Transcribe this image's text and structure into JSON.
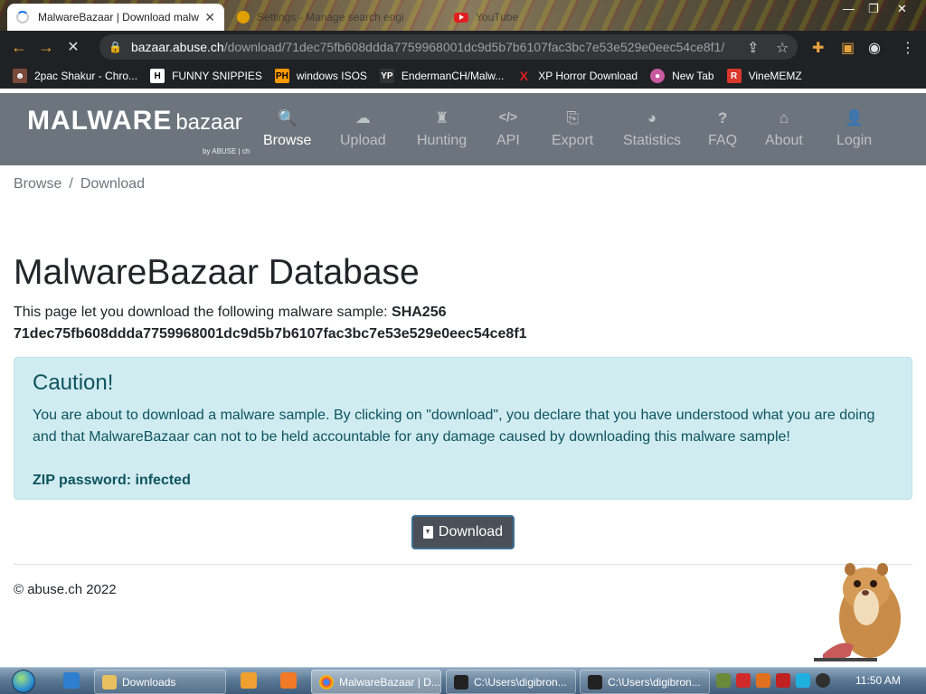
{
  "browser": {
    "tabs": [
      {
        "title": "MalwareBazaar | Download malw",
        "close": "✕"
      },
      {
        "title": "Settings - Manage search engi"
      },
      {
        "title": "YouTube"
      }
    ],
    "url_host": "bazaar.abuse.ch",
    "url_path": "/download/71dec75fb608ddda7759968001dc9d5b7b6107fac3bc7e53e529e0eec54ce8f1/",
    "bookmarks": [
      {
        "label": "2pac Shakur - Chro...",
        "icon": "2pac-icon",
        "color": "#c0392b"
      },
      {
        "label": "FUNNY SNIPPIES",
        "icon": "H-icon",
        "color": "#ffffff"
      },
      {
        "label": "windows ISOS",
        "icon": "PH-icon",
        "color": "#ff9900"
      },
      {
        "label": "EndermanCH/Malw...",
        "icon": "YP-icon",
        "color": "#333333"
      },
      {
        "label": "XP Horror Download",
        "icon": "X-icon",
        "color": "#e02020"
      },
      {
        "label": "New Tab",
        "icon": "newtab-icon",
        "color": "#c85aa0"
      },
      {
        "label": "VineMEMZ",
        "icon": "R-icon",
        "color": "#d9382b"
      }
    ]
  },
  "site": {
    "brand_main": "MALWARE",
    "brand_sub": "bazaar",
    "brand_by": "by ABUSE | ch",
    "nav": [
      {
        "label": "Browse",
        "icon": "search-icon",
        "glyph": "🔍"
      },
      {
        "label": "Upload",
        "icon": "cloud-upload-icon",
        "glyph": "☁"
      },
      {
        "label": "Hunting",
        "icon": "chess-rook-icon",
        "glyph": "♜"
      },
      {
        "label": "API",
        "icon": "code-icon",
        "glyph": "</>"
      },
      {
        "label": "Export",
        "icon": "file-export-icon",
        "glyph": "⎘"
      },
      {
        "label": "Statistics",
        "icon": "pie-chart-icon",
        "glyph": "◕"
      },
      {
        "label": "FAQ",
        "icon": "question-circle-icon",
        "glyph": "?"
      },
      {
        "label": "About",
        "icon": "landmark-icon",
        "glyph": "⌂"
      },
      {
        "label": "Login",
        "icon": "user-icon",
        "glyph": "👤"
      }
    ]
  },
  "breadcrumb": {
    "items": [
      "Browse",
      "Download"
    ],
    "separator": "/"
  },
  "page": {
    "title": "MalwareBazaar Database",
    "intro": "This page let you download the following malware sample:",
    "hash_label": "SHA256",
    "hash": "71dec75fb608ddda7759968001dc9d5b7b6107fac3bc7e53e529e0eec54ce8f1",
    "alert_title": "Caution!",
    "alert_body": "You are about to download a malware sample. By clicking on \"download\", you declare that you have understood what you are doing and that MalwareBazaar can not to be held accountable for any damage caused by downloading this malware sample!",
    "zip_password": "ZIP password: infected",
    "download_label": "Download",
    "footer": "© abuse.ch 2022"
  },
  "taskbar": {
    "buttons": [
      {
        "label": "Downloads"
      },
      {
        "label": "MalwareBazaar | D..."
      },
      {
        "label": "C:\\Users\\digibron..."
      },
      {
        "label": "C:\\Users\\digibron..."
      }
    ],
    "clock": "11:50 AM"
  },
  "colors": {
    "nav_bg": "#6c757d",
    "alert_bg": "#d1ecf1",
    "alert_text": "#0c5460",
    "button_bg": "#495057"
  }
}
